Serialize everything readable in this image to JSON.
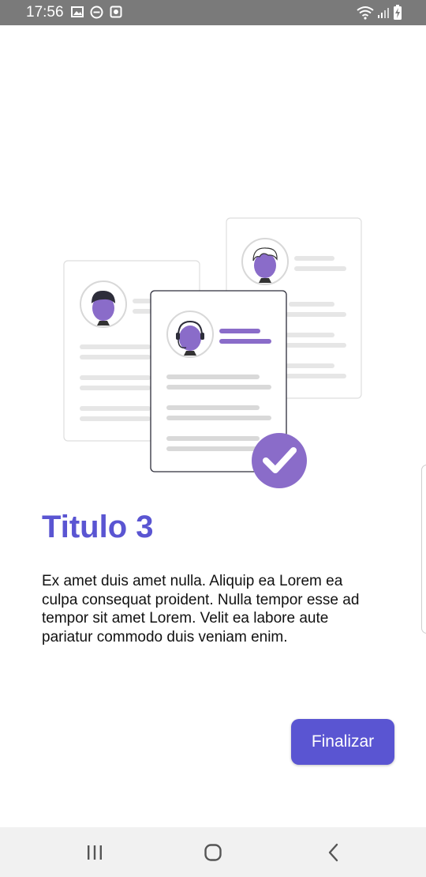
{
  "status_bar": {
    "time": "17:56",
    "left_icons": [
      "image-icon",
      "do-not-disturb-icon",
      "screen-record-icon"
    ],
    "right_icons": [
      "wifi-icon",
      "signal-icon",
      "battery-charging-icon"
    ]
  },
  "onboarding": {
    "title": "Titulo 3",
    "body": "Ex amet duis amet nulla. Aliquip ea Lorem ea culpa consequat proident. Nulla tempor esse ad tempor sit amet Lorem. Velit ea labore aute pariatur commodo duis veniam enim.",
    "finish_label": "Finalizar"
  },
  "nav_bar": {
    "buttons": [
      "recent-apps-icon",
      "home-icon",
      "back-icon"
    ]
  },
  "colors": {
    "accent": "#5a55d2",
    "illustration_purple": "#8a6cc9",
    "status_bar": "#7a7a7a"
  }
}
